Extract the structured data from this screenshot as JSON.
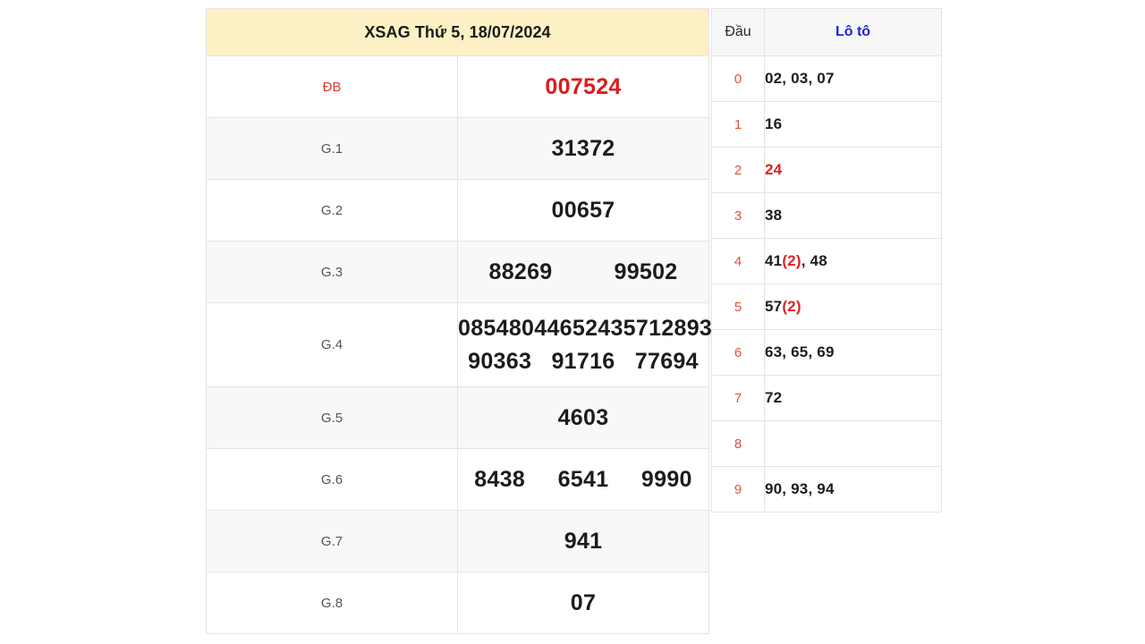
{
  "header": {
    "title": "XSAG Thứ 5, 18/07/2024"
  },
  "prizes": [
    {
      "label": "ĐB",
      "numbers": [
        "007524"
      ],
      "special": true
    },
    {
      "label": "G.1",
      "numbers": [
        "31372"
      ]
    },
    {
      "label": "G.2",
      "numbers": [
        "00657"
      ]
    },
    {
      "label": "G.3",
      "numbers": [
        "88269",
        "99502"
      ]
    },
    {
      "label": "G.4",
      "numbers": [
        "08548",
        "04465",
        "24357",
        "12893",
        "90363",
        "91716",
        "77694"
      ]
    },
    {
      "label": "G.5",
      "numbers": [
        "4603"
      ]
    },
    {
      "label": "G.6",
      "numbers": [
        "8438",
        "6541",
        "9990"
      ]
    },
    {
      "label": "G.7",
      "numbers": [
        "941"
      ]
    },
    {
      "label": "G.8",
      "numbers": [
        "07"
      ]
    }
  ],
  "loto": {
    "headers": {
      "dau": "Đầu",
      "loto": "Lô tô"
    },
    "rows": [
      {
        "dau": "0",
        "text": "02, 03, 07"
      },
      {
        "dau": "1",
        "text": "16"
      },
      {
        "dau": "2",
        "text": "24"
      },
      {
        "dau": "3",
        "text": "38"
      },
      {
        "dau": "4",
        "text": "41(2), 48"
      },
      {
        "dau": "5",
        "text": "57(2)"
      },
      {
        "dau": "6",
        "text": "63, 65, 69"
      },
      {
        "dau": "7",
        "text": "72"
      },
      {
        "dau": "8",
        "text": ""
      },
      {
        "dau": "9",
        "text": "90, 93, 94"
      }
    ]
  },
  "colors": {
    "header_bg": "#fdf0c4",
    "special_red": "#dd1b1b",
    "dau_red": "#e0513c",
    "loto_blue": "#2222dd",
    "border": "#e4e4e4",
    "row_alt": "#f8f8f8"
  }
}
